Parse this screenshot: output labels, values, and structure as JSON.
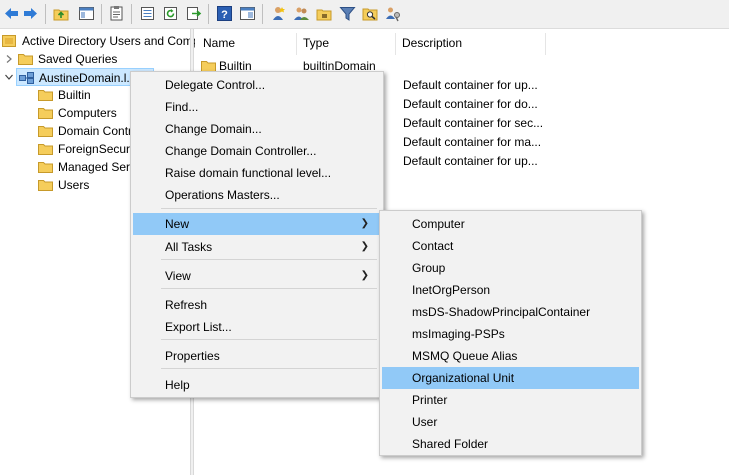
{
  "toolbar": {
    "buttons": [
      "back-arrow-icon",
      "forward-arrow-icon",
      "up-folder-icon",
      "show-hide-tree-icon",
      "properties-icon",
      "export-list-icon",
      "refresh-icon",
      "export-icon",
      "help-icon",
      "console-pane-icon",
      "new-user-icon",
      "new-group-icon",
      "new-ou-icon",
      "filter-icon",
      "find-icon",
      "delegate-icon"
    ]
  },
  "tree": {
    "root": "Active Directory Users and Computers",
    "saved_queries": "Saved Queries",
    "domain": "AustineDomain.l...",
    "children": [
      "Builtin",
      "Computers",
      "Domain Controllers",
      "ForeignSecurityPrincipals",
      "Managed Service Accounts",
      "Users"
    ]
  },
  "list": {
    "columns": [
      "Name",
      "Type",
      "Description"
    ],
    "rows": [
      {
        "name": "Builtin",
        "type": "builtinDomain",
        "description": ""
      },
      {
        "name": "",
        "type": "",
        "description": "Default container for up..."
      },
      {
        "name": "",
        "type": "",
        "description": "Default container for do..."
      },
      {
        "name": "",
        "type": "",
        "description": "Default container for sec..."
      },
      {
        "name": "",
        "type": "",
        "description": "Default container for ma..."
      },
      {
        "name": "",
        "type": "",
        "description": "Default container for up..."
      }
    ]
  },
  "context_menu": {
    "items": [
      "Delegate Control...",
      "Find...",
      "Change Domain...",
      "Change Domain Controller...",
      "Raise domain functional level...",
      "Operations Masters...",
      "New",
      "All Tasks",
      "View",
      "Refresh",
      "Export List...",
      "Properties",
      "Help"
    ],
    "highlighted": "New"
  },
  "submenu": {
    "items": [
      "Computer",
      "Contact",
      "Group",
      "InetOrgPerson",
      "msDS-ShadowPrincipalContainer",
      "msImaging-PSPs",
      "MSMQ Queue Alias",
      "Organizational Unit",
      "Printer",
      "User",
      "Shared Folder"
    ],
    "highlighted": "Organizational Unit"
  },
  "colors": {
    "highlight": "#91c9f7",
    "folder": "#f5cd5b",
    "tree_selection": "#cce8ff"
  }
}
